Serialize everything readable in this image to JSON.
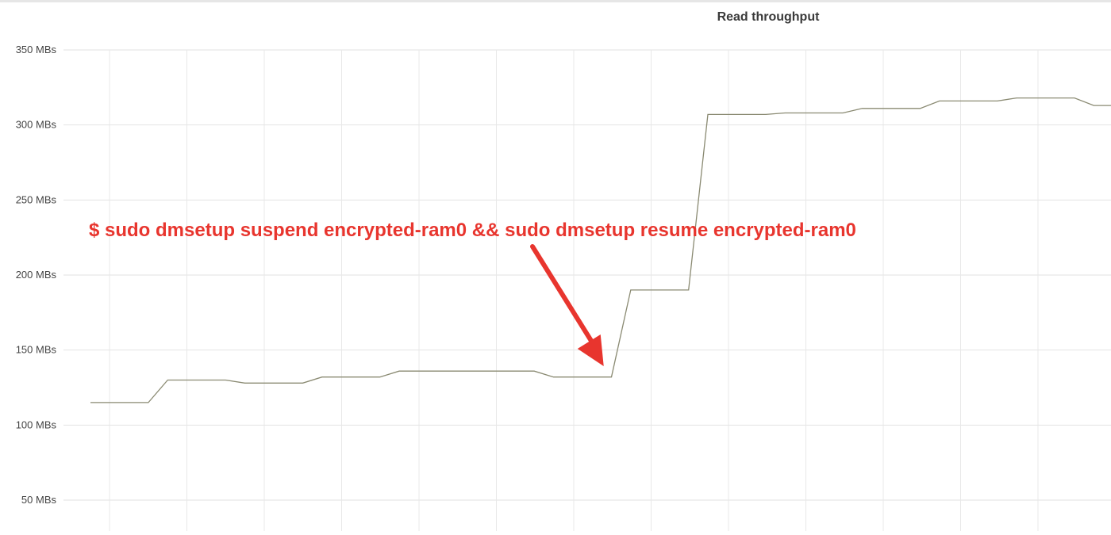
{
  "chart_data": {
    "type": "line",
    "title": "Read throughput",
    "xlabel": "",
    "ylabel": "",
    "ylim": [
      25,
      350
    ],
    "y_ticks": [
      {
        "value": 350,
        "label": "350 MBs"
      },
      {
        "value": 300,
        "label": "300 MBs"
      },
      {
        "value": 250,
        "label": "250 MBs"
      },
      {
        "value": 200,
        "label": "200 MBs"
      },
      {
        "value": 150,
        "label": "150 MBs"
      },
      {
        "value": 100,
        "label": "100 MBs"
      },
      {
        "value": 50,
        "label": "50 MBs"
      }
    ],
    "grid": true,
    "legend": "none",
    "line_color": "#8a8a72",
    "annotation": {
      "text": "$ sudo dmsetup suspend encrypted-ram0 && sudo dmsetup resume encrypted-ram0",
      "color": "#e8352e",
      "points_to_x": 26.6
    },
    "x": [
      0,
      3,
      4,
      7,
      8,
      11,
      12,
      15,
      16,
      19,
      20,
      23,
      24,
      27,
      28,
      31,
      32,
      35,
      36,
      39,
      40,
      43,
      44,
      47,
      48,
      51
    ],
    "series": [
      {
        "values": [
          115,
          115,
          130,
          130,
          128,
          128,
          132,
          132,
          136,
          136,
          136,
          136,
          132,
          132,
          190,
          190,
          307,
          307,
          308,
          308,
          311,
          311,
          316,
          316,
          318,
          318
        ]
      }
    ],
    "series_tail": {
      "x": [
        52,
        53
      ],
      "values": [
        313,
        313
      ]
    }
  }
}
